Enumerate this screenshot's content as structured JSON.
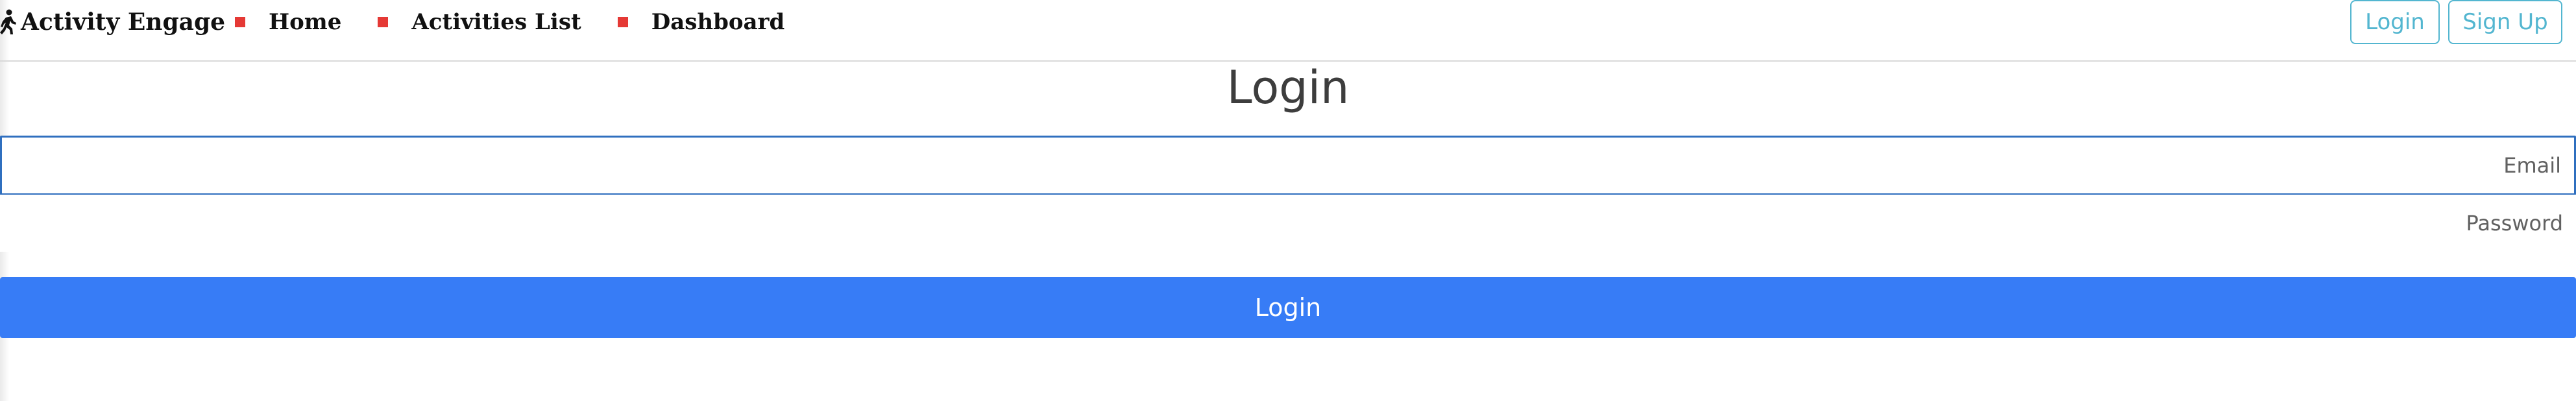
{
  "navbar": {
    "brand": "Activity Engage",
    "items": [
      {
        "label": "Home"
      },
      {
        "label": "Activities List"
      },
      {
        "label": "Dashboard"
      }
    ],
    "login_label": "Login",
    "signup_label": "Sign Up"
  },
  "form": {
    "title": "Login",
    "email": {
      "placeholder": "Email",
      "value": ""
    },
    "password": {
      "placeholder": "Password",
      "value": ""
    },
    "submit_label": "Login"
  },
  "icons": {
    "brand": "person-walking-icon",
    "nav_bullet": "red-square-bullet-icon"
  },
  "colors": {
    "accent": "#53b6d0",
    "primary_button": "#377cf6",
    "bullet": "#e53935",
    "focus_border": "#2f6fbf"
  }
}
